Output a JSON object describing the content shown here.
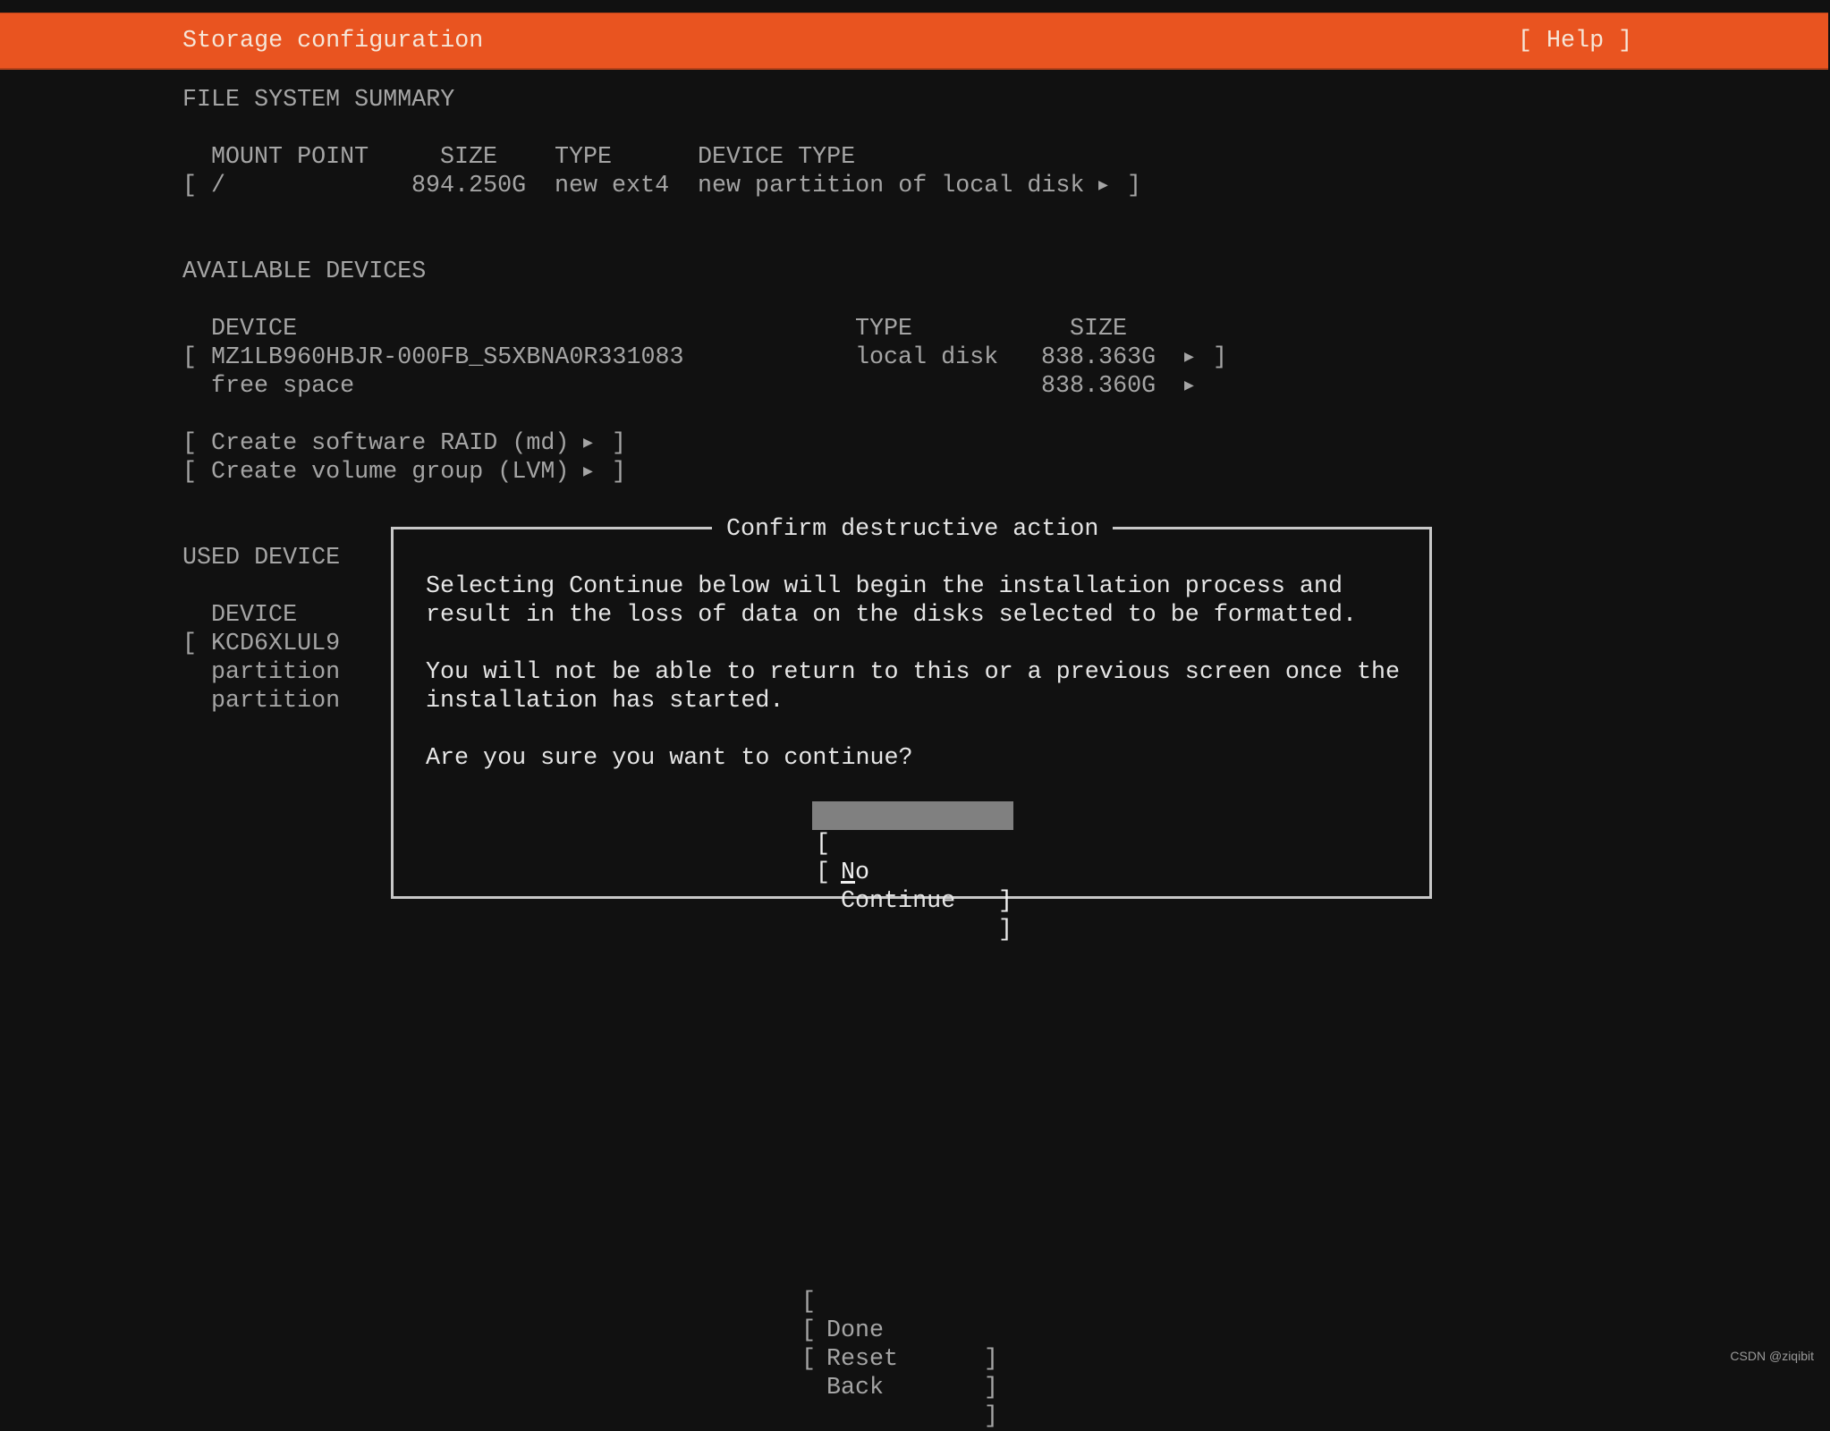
{
  "header": {
    "title": "Storage configuration",
    "help_label": "[ Help ]",
    "accent_color": "#e95420"
  },
  "file_system_summary": {
    "heading": "FILE SYSTEM SUMMARY",
    "columns": {
      "mount_point": "MOUNT POINT",
      "size": "SIZE",
      "type": "TYPE",
      "device_type": "DEVICE TYPE"
    },
    "rows": [
      {
        "mount_point": "/",
        "size": "894.250G",
        "type": "new ext4",
        "device_type": "new partition of local disk"
      }
    ]
  },
  "available_devices": {
    "heading": "AVAILABLE DEVICES",
    "columns": {
      "device": "DEVICE",
      "type": "TYPE",
      "size": "SIZE"
    },
    "rows": [
      {
        "device": "MZ1LB960HBJR-000FB_S5XBNA0R331083",
        "type": "local disk",
        "size": "838.363G"
      },
      {
        "device": "free space",
        "type": "",
        "size": "838.360G"
      }
    ],
    "actions": [
      "Create software RAID (md)",
      "Create volume group (LVM)"
    ]
  },
  "used_devices": {
    "heading": "USED DEVICE",
    "columns": {
      "device": "DEVICE"
    },
    "rows": [
      {
        "device": "KCD6XLUL9"
      },
      {
        "device": "partition"
      },
      {
        "device": "partition"
      }
    ]
  },
  "dialog": {
    "title": "Confirm destructive action",
    "paragraphs": [
      [
        "Selecting Continue below will begin the installation process and",
        "result in the loss of data on the disks selected to be formatted."
      ],
      [
        "You will not be able to return to this or a previous screen once the",
        "installation has started."
      ],
      [
        "Are you sure you want to continue?"
      ]
    ],
    "buttons": {
      "no": {
        "label_first": "N",
        "label_rest": "o",
        "focused": true
      },
      "continue": {
        "label": "Continue",
        "focused": false
      }
    }
  },
  "footer_buttons": [
    "Done",
    "Reset",
    "Back"
  ],
  "symbols": {
    "arrow": "▶",
    "open_bracket": "[",
    "close_bracket": "]"
  },
  "watermark": "CSDN @ziqibit"
}
